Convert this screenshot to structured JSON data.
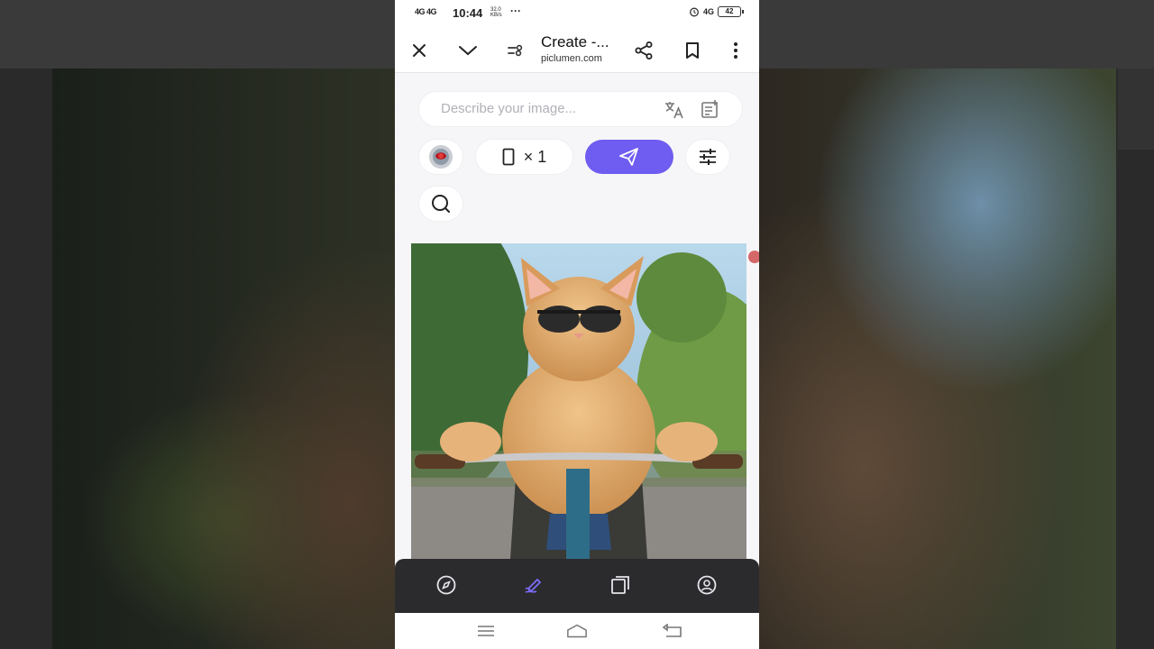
{
  "status_bar": {
    "signal": "4G 4G",
    "time": "10:44",
    "speed": "32.0 KB/s",
    "dots": "···",
    "network": "4G",
    "battery": "42"
  },
  "browser": {
    "title": "Create -...",
    "url": "piclumen.com",
    "icons": [
      "close-icon",
      "chevron-down-icon",
      "tabs-settings-icon",
      "share-icon",
      "bookmark-icon",
      "more-vert-icon"
    ]
  },
  "prompt": {
    "placeholder": "Describe your image...",
    "icons": [
      "translate-icon",
      "prompt-list-icon"
    ]
  },
  "controls": {
    "ratio_count": "× 1",
    "icons": [
      "model-avatar",
      "portrait-ratio-icon",
      "send-icon",
      "sliders-icon",
      "search-icon"
    ]
  },
  "generated_image": {
    "subject": "cat-riding-bicycle-image"
  },
  "bottom_nav": {
    "items": [
      "explore-icon",
      "create-icon",
      "gallery-icon",
      "profile-icon"
    ],
    "active": "create-icon",
    "active_color": "#7b6cf6"
  },
  "colors": {
    "accent": "#6f5cf0",
    "nav_bg": "#2b2b2e"
  }
}
